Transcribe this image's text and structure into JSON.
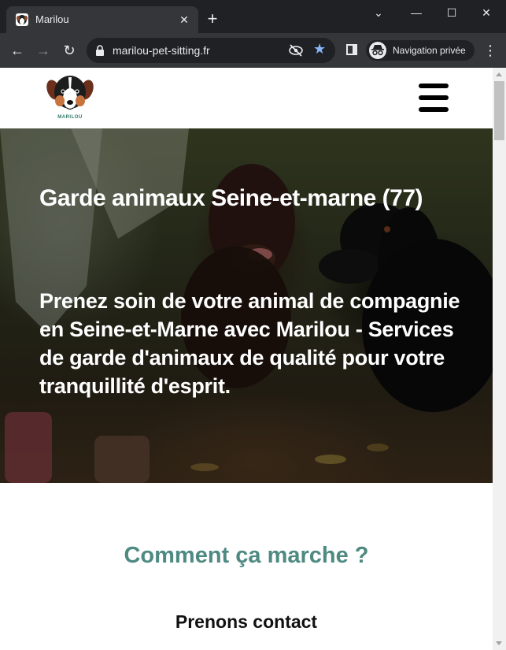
{
  "browser": {
    "tab_title": "Marilou",
    "tab_close": "✕",
    "new_tab": "+",
    "url": "marilou-pet-sitting.fr",
    "incognito_label": "Navigation privée",
    "back_icon": "←",
    "forward_icon": "→",
    "reload_icon": "↻",
    "star_icon": "★",
    "menu_icon": "⋮",
    "win_chevron": "⌄",
    "win_minimize": "—",
    "win_maximize": "☐",
    "win_close": "✕"
  },
  "site": {
    "logo_text": "MARILOU",
    "hero_title": "Garde animaux Seine-et-marne (77)",
    "hero_subtitle": "Prenez soin de votre animal de compagnie en Seine-et-Marne avec Marilou - Services de garde d'animaux de qualité pour votre tranquillité d'esprit.",
    "section_title": "Comment ça marche ?",
    "step_title": "Prenons contact"
  },
  "colors": {
    "accent": "#4f8a82",
    "chrome_bg": "#202124",
    "toolbar_bg": "#35363a",
    "star": "#8ab4f8"
  }
}
